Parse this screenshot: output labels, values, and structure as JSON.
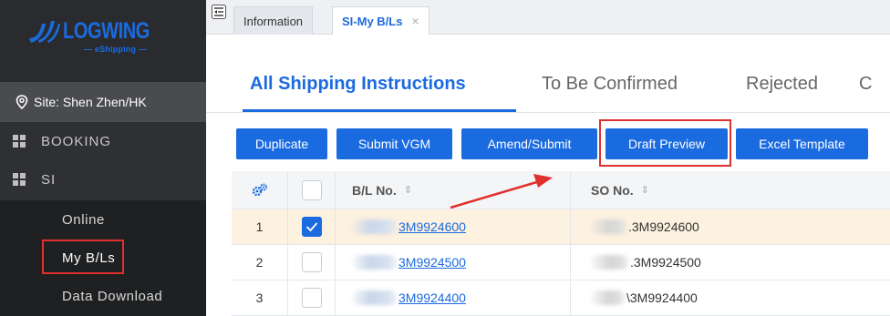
{
  "logo": {
    "name": "LOGWING",
    "tagline": "— eShipping —"
  },
  "sidebar": {
    "site_label": "Site: Shen Zhen/HK",
    "menu": [
      {
        "label": "BOOKING",
        "icon": "grid-icon"
      },
      {
        "label": "SI",
        "icon": "grid-icon"
      }
    ],
    "si_submenu": [
      "Online",
      "My B/Ls",
      "Data Download"
    ]
  },
  "tabs": [
    {
      "label": "Information"
    },
    {
      "label": "SI-My B/Ls",
      "close": "×"
    }
  ],
  "subtabs": [
    "All Shipping Instructions",
    "To Be Confirmed",
    "Rejected",
    "C"
  ],
  "toolbar": {
    "duplicate": "Duplicate",
    "submit_vgm": "Submit VGM",
    "amend_submit": "Amend/Submit",
    "draft_preview": "Draft Preview",
    "excel_template": "Excel Template"
  },
  "table": {
    "headers": {
      "bl_no": "B/L No.",
      "so_no": "SO No.",
      "sort_glyph": "⇕"
    },
    "rows": [
      {
        "index": "1",
        "checked": true,
        "bl_no": "3M9924600",
        "so_no": ".3M9924600"
      },
      {
        "index": "2",
        "checked": false,
        "bl_no": "3M9924500",
        "so_no": ".3M9924500"
      },
      {
        "index": "3",
        "checked": false,
        "bl_no": "3M9924400",
        "so_no": "\\3M9924400"
      }
    ]
  },
  "colors": {
    "accent": "#1b6be0",
    "highlight": "#e0302e",
    "sidebar_bg": "#2f3033",
    "selected_row": "#fdf1df"
  }
}
